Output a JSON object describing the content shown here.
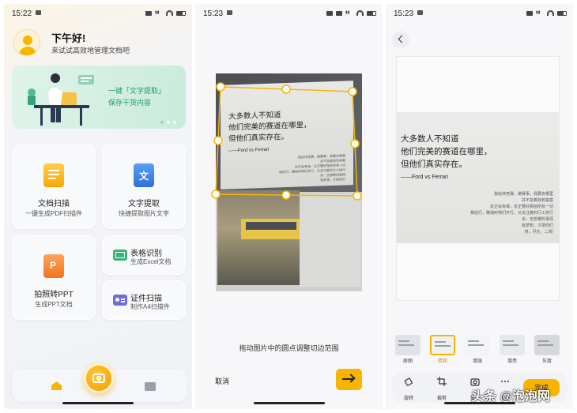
{
  "home": {
    "status_time": "15:22",
    "greeting": "下午好!",
    "greeting_sub": "来试试高效地管理文档吧",
    "banner": {
      "line1": "一键「文字提取」",
      "line2": "保存干货内容"
    },
    "cards": {
      "doc_scan": {
        "title": "文档扫描",
        "sub": "一键生成PDF扫描件"
      },
      "text_extract": {
        "title": "文字提取",
        "sub": "快捷提取图片文字"
      },
      "photo_ppt": {
        "title": "拍照转PPT",
        "sub": "生成PPT文档"
      },
      "table_recog": {
        "title": "表格识别",
        "sub": "生成Excel文档"
      },
      "id_scan": {
        "title": "证件扫描",
        "sub": "制作A4扫描件"
      }
    },
    "icons": {
      "home": "home-icon",
      "camera": "camera-icon",
      "folder": "folder-icon"
    }
  },
  "crop": {
    "status_time": "15:23",
    "hint": "拖动图片中的圆点调整切边范围",
    "cancel_label": "取消",
    "next_icon": "arrow-right-icon"
  },
  "book": {
    "line1": "大多数人不知道",
    "line2": "他们完美的赛道在哪里，",
    "line3": "但他们真实存在。",
    "credit": "——Ford vs Ferrari",
    "small_text": [
      "我给持竞赛、做赛事，我要去哪里",
      "并不急着找到答案",
      "反正会有缘，反正要好相信所有一切",
      "相信行，赚钱时特们开行，又关注着的行工技行",
      "多，去想哪的事情",
      "有梦想、才把你们",
      "拼，尽在、二/阶"
    ]
  },
  "edit": {
    "status_time": "15:23",
    "filters": [
      {
        "label": "原图",
        "selected": false
      },
      {
        "label": "柔和",
        "selected": true
      },
      {
        "label": "增强",
        "selected": false
      },
      {
        "label": "增亮",
        "selected": false
      },
      {
        "label": "灰度",
        "selected": false
      }
    ],
    "tools": [
      {
        "label": "旋转",
        "icon": "rotate-icon"
      },
      {
        "label": "裁剪",
        "icon": "crop-icon"
      },
      {
        "label": "重拍",
        "icon": "camera-icon"
      },
      {
        "label": "更多",
        "icon": "more-icon"
      }
    ],
    "done_label": "完成"
  },
  "watermark": "头条 @泡泡网",
  "colors": {
    "accent": "#f7b500",
    "green": "#1e9c68",
    "orange": "#f7941d",
    "blue": "#2f6fd8"
  }
}
